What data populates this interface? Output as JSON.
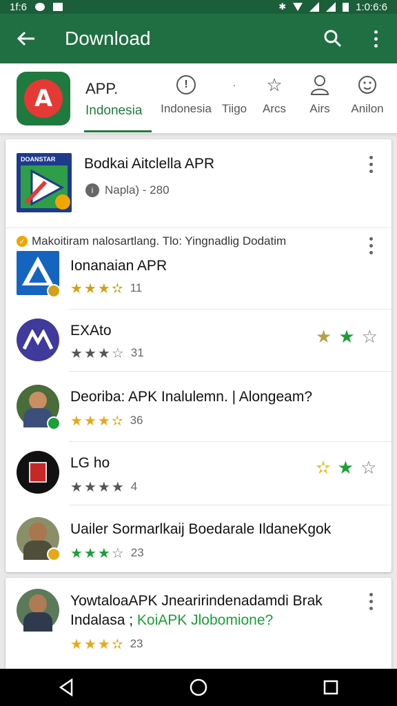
{
  "status_bar": {
    "left_text": "1f:6",
    "time": "1:0:6:6"
  },
  "app_bar": {
    "title": "Download"
  },
  "category_bar": {
    "app_label": "APP.",
    "active_tab": "Indonesia",
    "items": [
      {
        "label": "Indonesia",
        "icon": "info-circle-icon"
      },
      {
        "label": "Tiigo",
        "icon": "dot-icon"
      },
      {
        "label": "Arcs",
        "icon": "star-outline-icon"
      },
      {
        "label": "Airs",
        "icon": "person-icon"
      },
      {
        "label": "Anilon",
        "icon": "smiley-icon"
      }
    ]
  },
  "featured": {
    "name": "Bodkai Aitclella APR",
    "sub": "Napla) - 280",
    "thumb_text": "DOANSTAR"
  },
  "note": "Makoitiram nalosartlang. Tlo: Yingnadlig Dodatim",
  "apps": [
    {
      "name": "Ionanaian APR",
      "rating": 3.5,
      "count": "11",
      "star_color": "#d4a015"
    },
    {
      "name": "EXAto",
      "rating": 3,
      "count": "31",
      "star_color": "#555555"
    },
    {
      "name": "Deoriba: APK Inalulemn. | Alongeam?",
      "rating": 3.5,
      "count": "36",
      "star_color": "#e6a817"
    },
    {
      "name": "LG ho",
      "rating": 4,
      "count": "4",
      "star_color": "#555555"
    },
    {
      "name": "Uailer Sormarlkaij Boedarale IldaneKgok",
      "rating": 3,
      "count": "23",
      "star_color": "#1aa035"
    }
  ],
  "card2_app": {
    "name_line1": "YowtaloaAPK Jnearirindenadamdi Brak",
    "name_line2_a": "Indalasa ;",
    "name_line2_b": "KoiAPK Jlobomione?",
    "rating": 3.5,
    "count": "23"
  },
  "colors": {
    "primary": "#1f6f43",
    "status_bar": "#1b5e3a",
    "accent_green": "#1aa035",
    "star_gold": "#e6a817"
  }
}
